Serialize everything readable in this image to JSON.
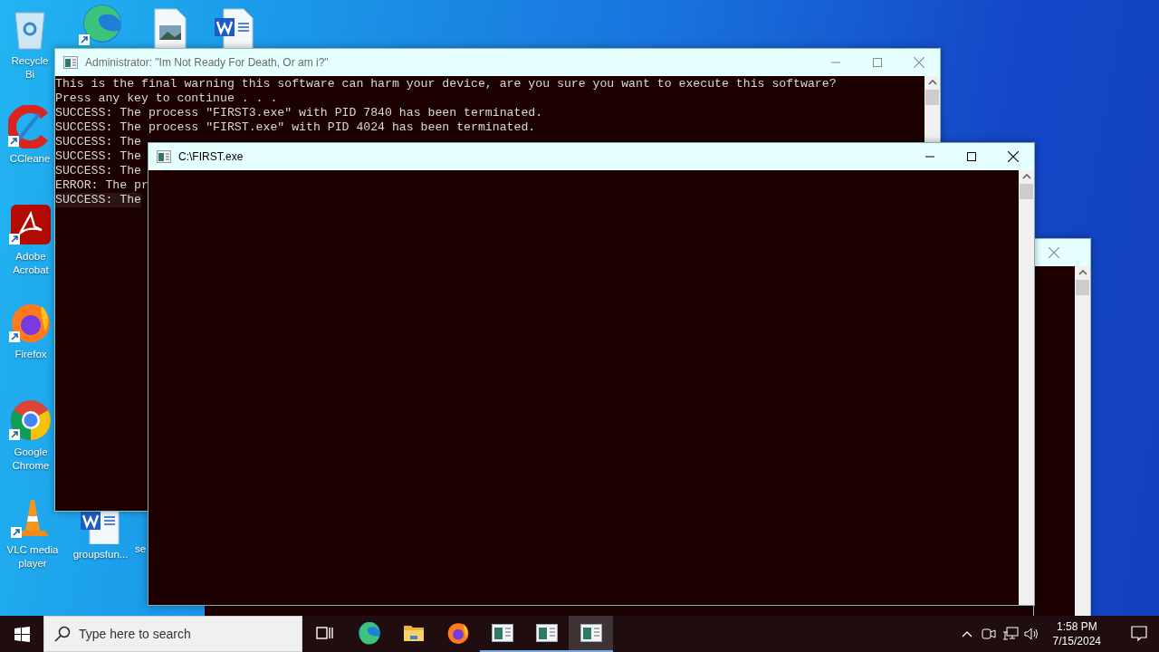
{
  "desktop_icons": [
    {
      "kind": "recycle-bin",
      "label": "Recycle Bi"
    },
    {
      "kind": "edge"
    },
    {
      "kind": "image-file"
    },
    {
      "kind": "word-doc"
    },
    {
      "kind": "ccleaner",
      "label": "CCleane"
    },
    {
      "kind": "acrobat",
      "label": "Adobe Acrobat"
    },
    {
      "kind": "firefox",
      "label": "Firefox"
    },
    {
      "kind": "chrome",
      "label": "Google Chrome"
    },
    {
      "kind": "vlc",
      "label": "VLC media player"
    },
    {
      "kind": "word-doc",
      "label": "groupsfun..."
    },
    {
      "kind": "hidden",
      "label": "se"
    }
  ],
  "windows": [
    {
      "title": "Administrator:  \"Im Not Ready For Death, Or am i?\"",
      "active": false,
      "lines": [
        "This is the final warning this software can harm your device, are you sure you want to execute this software?",
        "Press any key to continue . . .",
        "SUCCESS: The process \"FIRST3.exe\" with PID 7840 has been terminated.",
        "SUCCESS: The process \"FIRST.exe\" with PID 4024 has been terminated.",
        "SUCCESS: The",
        "SUCCESS: The",
        "SUCCESS: The",
        "ERROR: The pr",
        "SUCCESS: The"
      ]
    },
    {
      "title": "C:\\FIRST.exe",
      "active": true
    },
    {
      "active": false
    }
  ],
  "taskbar": {
    "search": {
      "placeholder": "Type here to search"
    },
    "apps": [
      {
        "kind": "task-view",
        "running": false,
        "selected": false
      },
      {
        "kind": "edge",
        "running": false,
        "selected": false
      },
      {
        "kind": "explorer",
        "running": false,
        "selected": false
      },
      {
        "kind": "firefox",
        "running": false,
        "selected": false
      },
      {
        "kind": "console",
        "running": true,
        "selected": false
      },
      {
        "kind": "console",
        "running": true,
        "selected": false
      },
      {
        "kind": "console",
        "running": true,
        "selected": true
      }
    ],
    "clock": {
      "time": "1:58 PM",
      "date": "7/15/2024"
    }
  }
}
